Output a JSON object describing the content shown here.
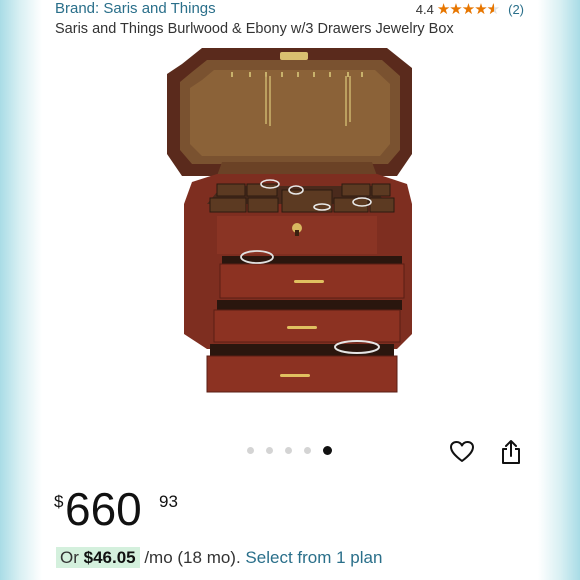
{
  "header": {
    "brand": "Brand: Saris and Things",
    "rating_value": "4.4",
    "rating_count": "(2)",
    "stars": "★★★★"
  },
  "product": {
    "title": "Saris and Things Burlwood & Ebony w/3 Drawers Jewelry Box",
    "image_icon": "jewelry-box-image",
    "carousel": {
      "total": 5,
      "active_index": 5
    }
  },
  "actions": {
    "wishlist_icon": "heart-icon",
    "share_icon": "share-icon"
  },
  "price": {
    "symbol": "$",
    "whole": "660",
    "fraction": "93"
  },
  "installment": {
    "prefix": "Or ",
    "amount": "$46.05",
    "term": " /mo (18 mo). ",
    "link": "Select from 1 plan"
  },
  "colors": {
    "link": "#2a6f8a",
    "star": "#e77600",
    "installment_highlight": "#d4f0dd"
  }
}
